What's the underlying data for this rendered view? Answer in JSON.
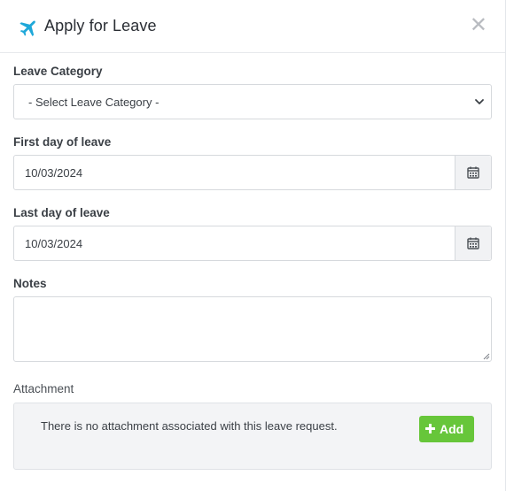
{
  "header": {
    "title": "Apply for Leave",
    "icon": "airplane-icon",
    "close_icon": "close-icon",
    "accent_color": "#1fa8d9"
  },
  "leave_category": {
    "label": "Leave Category",
    "selected": "- Select Leave Category -"
  },
  "first_day": {
    "label": "First day of leave",
    "value": "10/03/2024",
    "icon": "calendar-icon"
  },
  "last_day": {
    "label": "Last day of leave",
    "value": "10/03/2024",
    "icon": "calendar-icon"
  },
  "notes": {
    "label": "Notes",
    "value": ""
  },
  "attachment": {
    "label": "Attachment",
    "message": "There is no attachment associated with this leave request.",
    "add_label": "Add",
    "add_icon": "plus-icon",
    "add_color": "#67c63a"
  }
}
